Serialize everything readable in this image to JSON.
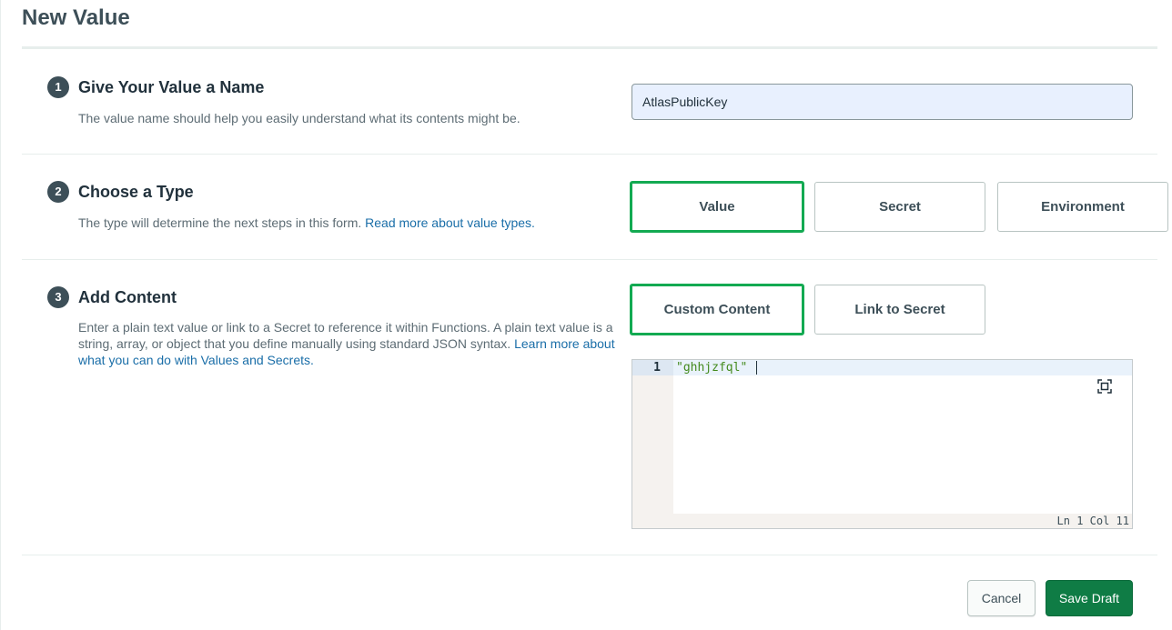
{
  "page": {
    "title": "New Value"
  },
  "sections": {
    "name": {
      "step": "1",
      "title": "Give Your Value a Name",
      "description": "The value name should help you easily understand what its contents might be.",
      "input_value": "AtlasPublicKey"
    },
    "type": {
      "step": "2",
      "title": "Choose a Type",
      "description": "The type will determine the next steps in this form.",
      "link_text": "Read more about value types.",
      "options": [
        "Value",
        "Secret",
        "Environment"
      ],
      "selected": "Value"
    },
    "content": {
      "step": "3",
      "title": "Add Content",
      "description": "Enter a plain text value or link to a Secret to reference it within Functions. A plain text value is a string, array, or object that you define manually using standard JSON syntax.",
      "link_text": "Learn more about what you can do with Values and Secrets.",
      "options": [
        "Custom Content",
        "Link to Secret"
      ],
      "selected": "Custom Content"
    }
  },
  "editor": {
    "line_number": "1",
    "code": "\"ghhjzfql\"",
    "status": "Ln 1 Col 11",
    "icon": "expand-icon"
  },
  "footer": {
    "cancel_label": "Cancel",
    "save_label": "Save Draft"
  },
  "colors": {
    "selected_border": "#13aa52",
    "save_button": "#0f7c45",
    "badge": "#3d4f58",
    "link": "#1a6ea8"
  }
}
